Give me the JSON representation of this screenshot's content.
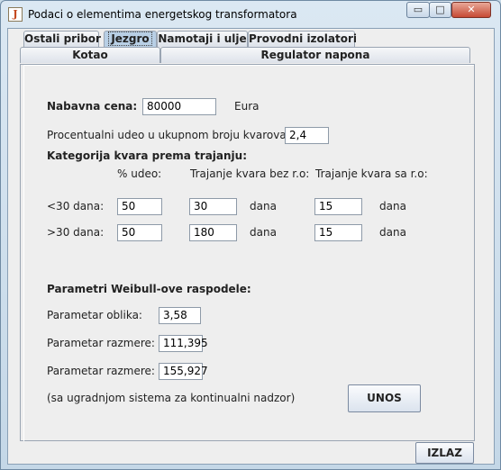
{
  "window": {
    "title": "Podaci o elementima energetskog transformatora",
    "app_icon": "java-icon",
    "controls": {
      "minimize": "▭",
      "maximize": "□",
      "close": "✕"
    }
  },
  "tabs_row1": [
    {
      "label": "Ostali pribor",
      "selected": false
    },
    {
      "label": "Jezgro",
      "selected": true
    },
    {
      "label": "Namotaji i ulje",
      "selected": false
    },
    {
      "label": "Provodni izolatori",
      "selected": false
    }
  ],
  "tabs_row2": [
    {
      "label": "Kotao",
      "selected": false
    },
    {
      "label": "Regulator napona",
      "selected": false
    }
  ],
  "form": {
    "nabavna_cena_label": "Nabavna cena:",
    "nabavna_cena_value": "80000",
    "currency": "Eura",
    "udeo_label": "Procentualni udeo u ukupnom broju kvarova:",
    "udeo_value": "2,4",
    "kategorija_label": "Kategorija kvara prema trajanju:",
    "col_udeo": "% udeo:",
    "col_bez": "Trajanje kvara bez r.o:",
    "col_sa": "Trajanje kvara sa r.o:",
    "rows": [
      {
        "label": "<30 dana:",
        "udeo": "50",
        "bez": "30",
        "sa": "15",
        "unit": "dana"
      },
      {
        "label": ">30 dana:",
        "udeo": "50",
        "bez": "180",
        "sa": "15",
        "unit": "dana"
      }
    ],
    "weibull_label": "Parametri Weibull-ove raspodele:",
    "oblik_label": "Parametar oblika:",
    "oblik_value": "3,58",
    "razmere1_label": "Parametar razmere:",
    "razmere1_value": "111,395",
    "razmere2_label": "Parametar razmere:",
    "razmere2_value": "155,927",
    "note": "(sa ugradnjom sistema za kontinualni nadzor)",
    "unos_button": "UNOS"
  },
  "izlaz_button": "IZLAZ"
}
